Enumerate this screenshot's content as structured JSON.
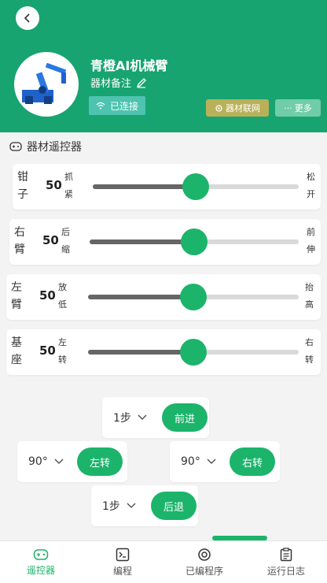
{
  "header": {
    "title": "青橙AI机械臂",
    "note": "器材备注",
    "status": "已连接",
    "iot_label": "器材联网",
    "more_label": "更多"
  },
  "section": {
    "title": "器材遥控器"
  },
  "sliders": [
    {
      "label": "钳子",
      "value": "50",
      "left": "抓紧",
      "right": "松开",
      "level": 0.5
    },
    {
      "label": "右臂",
      "value": "50",
      "left": "后缩",
      "right": "前伸",
      "level": 0.5
    },
    {
      "label": "左臂",
      "value": "50",
      "left": "放低",
      "right": "抬高",
      "level": 0.5
    },
    {
      "label": "基座",
      "value": "50",
      "left": "左转",
      "right": "右转",
      "level": 0.5
    }
  ],
  "controls": {
    "forward": {
      "step": "1步",
      "label": "前进"
    },
    "left": {
      "step": "90°",
      "label": "左转"
    },
    "right": {
      "step": "90°",
      "label": "右转"
    },
    "back": {
      "step": "1步",
      "label": "后退"
    }
  },
  "nav": [
    {
      "label": "遥控器",
      "icon": "gamepad-icon",
      "active": true
    },
    {
      "label": "编程",
      "icon": "terminal-icon",
      "active": false
    },
    {
      "label": "已编程序",
      "icon": "program-icon",
      "active": false
    },
    {
      "label": "运行日志",
      "icon": "log-icon",
      "active": false
    }
  ],
  "colors": {
    "header": "#17a470",
    "accent": "#1bb46a"
  }
}
